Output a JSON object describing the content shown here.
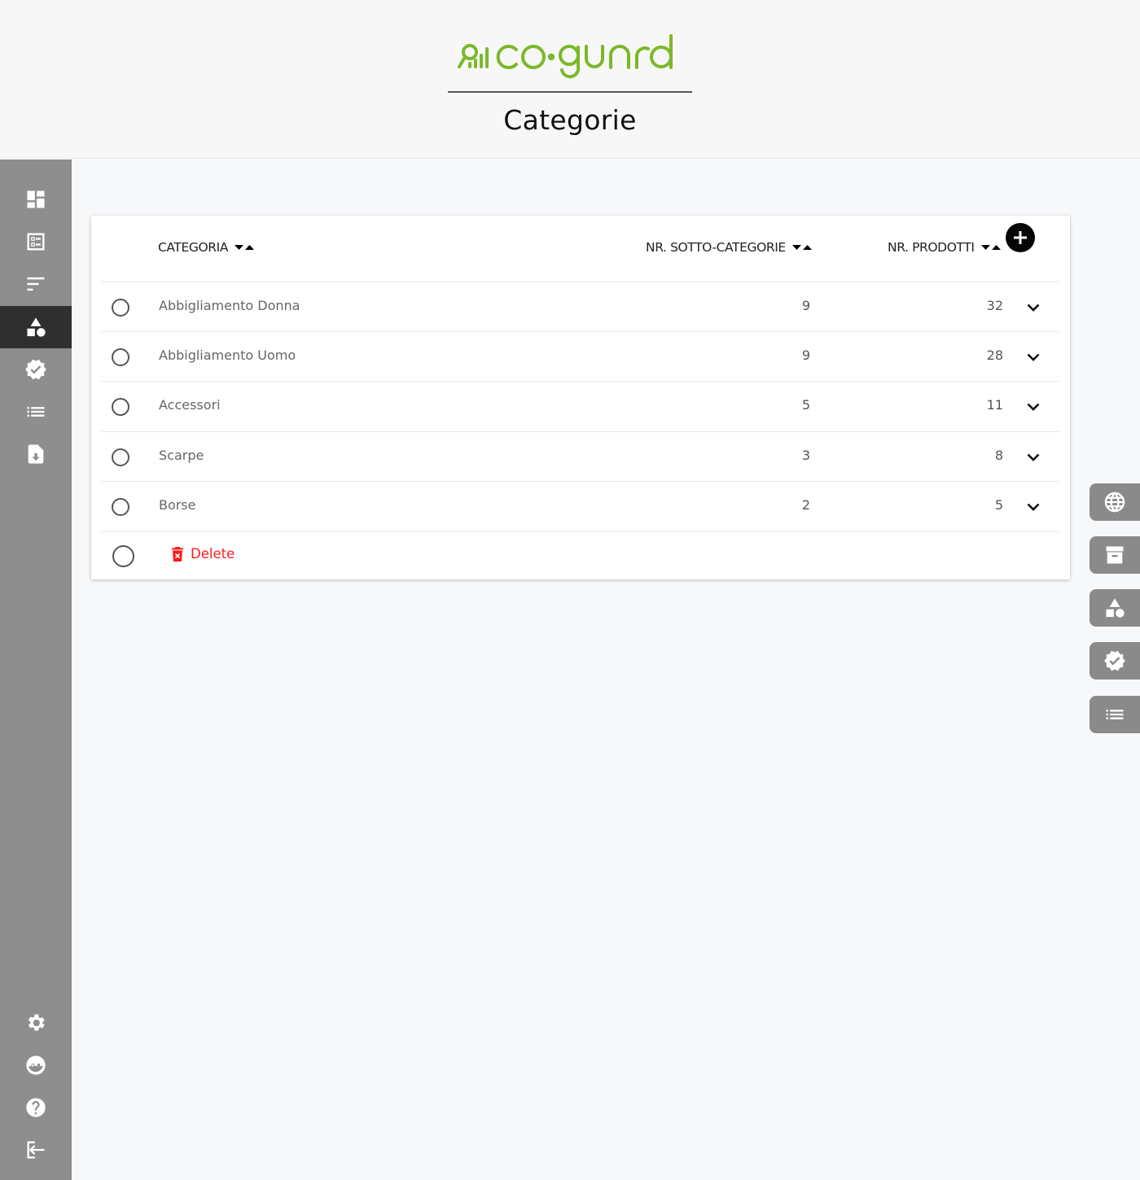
{
  "brand": {
    "name": "co·guard",
    "color": "#7ab929"
  },
  "page": {
    "title": "Categorie"
  },
  "sidebar": {
    "items": [
      {
        "icon": "dashboard-icon",
        "active": false
      },
      {
        "icon": "list-alt-icon",
        "active": false
      },
      {
        "icon": "sort-icon",
        "active": false
      },
      {
        "icon": "category-icon",
        "active": true
      },
      {
        "icon": "verified-icon",
        "active": false
      },
      {
        "icon": "list-icon",
        "active": false
      },
      {
        "icon": "file-download-icon",
        "active": false
      }
    ],
    "bottom_items": [
      {
        "icon": "settings-icon"
      },
      {
        "icon": "face-icon"
      },
      {
        "icon": "help-icon"
      },
      {
        "icon": "logout-icon"
      }
    ],
    "active_color": "#2f2f2f"
  },
  "table": {
    "columns": {
      "categoria": "CATEGORIA",
      "sotto_categorie": "NR. SOTTO-CATEGORIE",
      "prodotti": "NR. PRODOTTI"
    },
    "rows": [
      {
        "name": "Abbigliamento Donna",
        "sub": "9",
        "prod": "32"
      },
      {
        "name": "Abbigliamento Uomo",
        "sub": "9",
        "prod": "28"
      },
      {
        "name": "Accessori",
        "sub": "5",
        "prod": "11"
      },
      {
        "name": "Scarpe",
        "sub": "3",
        "prod": "8"
      },
      {
        "name": "Borse",
        "sub": "2",
        "prod": "5"
      }
    ],
    "delete_label": "Delete",
    "delete_color": "#ff1a1a"
  },
  "right_tabs": [
    {
      "icon": "globe-icon"
    },
    {
      "icon": "archive-icon"
    },
    {
      "icon": "category-icon"
    },
    {
      "icon": "verified-icon"
    },
    {
      "icon": "list-icon"
    }
  ]
}
